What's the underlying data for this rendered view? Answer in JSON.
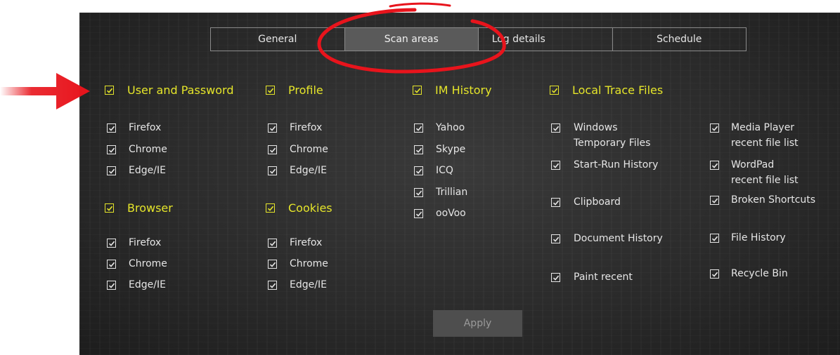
{
  "tabs": [
    "General",
    "Scan areas",
    "Log details",
    "Schedule"
  ],
  "active_tab": "Scan areas",
  "sections": {
    "user_password": {
      "title": "User and Password",
      "items": [
        "Firefox",
        "Chrome",
        "Edge/IE"
      ]
    },
    "profile": {
      "title": "Profile",
      "items": [
        "Firefox",
        "Chrome",
        "Edge/IE"
      ]
    },
    "browser": {
      "title": "Browser",
      "items": [
        "Firefox",
        "Chrome",
        "Edge/IE"
      ]
    },
    "cookies": {
      "title": "Cookies",
      "items": [
        "Firefox",
        "Chrome",
        "Edge/IE"
      ]
    },
    "im_history": {
      "title": "IM History",
      "items": [
        "Yahoo",
        "Skype",
        "ICQ",
        "Trillian",
        "ooVoo"
      ]
    },
    "local_trace": {
      "title": "Local Trace Files",
      "col1": [
        "Windows\nTemporary Files",
        "Start-Run History",
        "Clipboard",
        "Document History",
        "Paint recent"
      ],
      "col2": [
        "Media Player\nrecent file list",
        "WordPad\nrecent file list",
        "Broken Shortcuts",
        "File History",
        "Recycle Bin"
      ]
    }
  },
  "apply_label": "Apply",
  "colors": {
    "accent": "#e5e52a",
    "annotation": "#e8141c",
    "text": "#e6e6e6"
  },
  "icons": [
    "checkbox-checked-icon",
    "red-arrow-annotation",
    "red-ellipse-annotation"
  ]
}
